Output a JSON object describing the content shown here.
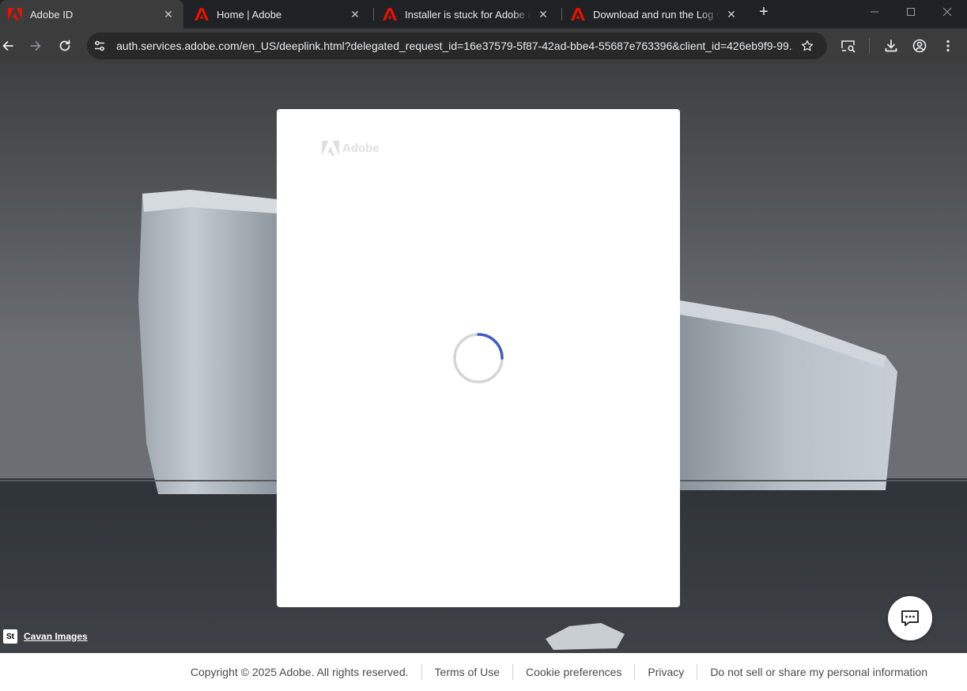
{
  "browser": {
    "tabs": [
      {
        "title": "Adobe ID",
        "active": true
      },
      {
        "title": "Home | Adobe",
        "active": false
      },
      {
        "title": "Installer is stuck for Adobe apps",
        "active": false
      },
      {
        "title": "Download and run the Log Collector",
        "active": false
      }
    ],
    "new_tab_label": "+",
    "url": "auth.services.adobe.com/en_US/deeplink.html?delegated_request_id=16e37579-5f87-42ad-bbe4-55687e763396&client_id=426eb9f9-99..."
  },
  "card": {
    "logo_text": "Adobe",
    "loading_progress": 0.25
  },
  "background": {
    "credit_badge": "St",
    "credit_name": "Cavan Images"
  },
  "footer": {
    "copyright": "Copyright © 2025 Adobe. All rights reserved.",
    "terms": "Terms of Use",
    "cookies": "Cookie preferences",
    "privacy": "Privacy",
    "do_not_sell": "Do not sell or share my personal information"
  },
  "colors": {
    "adobe_red": "#eb1000",
    "spinner_accent": "#3f5cc8",
    "spinner_track": "#d5d5d5"
  },
  "icons": {
    "back": "arrow-left-icon",
    "forward": "arrow-right-icon",
    "reload": "reload-icon",
    "site_info": "tune-icon",
    "bookmark": "star-icon",
    "cast": "cast-search-icon",
    "download": "download-icon",
    "profile": "account-circle-icon",
    "menu": "kebab-menu-icon",
    "chat": "chat-bubble-icon"
  }
}
